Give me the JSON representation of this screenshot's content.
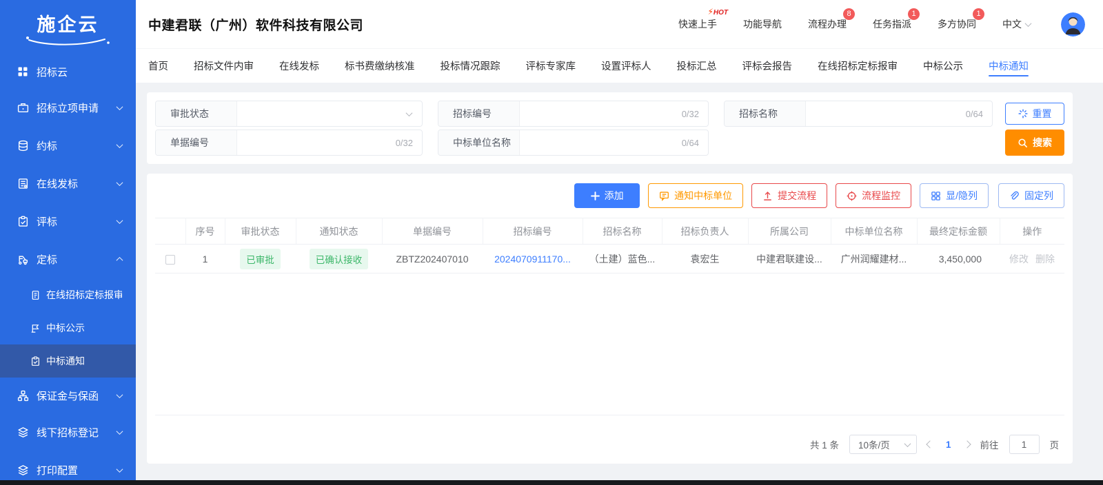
{
  "app": {
    "logo_text": "施企云"
  },
  "sidebar": {
    "items": [
      {
        "label": "招标云"
      },
      {
        "label": "招标立项申请"
      },
      {
        "label": "约标"
      },
      {
        "label": "在线发标"
      },
      {
        "label": "评标"
      },
      {
        "label": "定标"
      },
      {
        "label": "在线招标定标报审"
      },
      {
        "label": "中标公示"
      },
      {
        "label": "中标通知"
      },
      {
        "label": "保证金与保函"
      },
      {
        "label": "线下招标登记"
      },
      {
        "label": "打印配置"
      }
    ]
  },
  "header": {
    "company_title": "中建君联（广州）软件科技有限公司",
    "nav": [
      {
        "label": "快速上手",
        "badge": "HOT"
      },
      {
        "label": "功能导航"
      },
      {
        "label": "流程办理",
        "badge": "8"
      },
      {
        "label": "任务指派",
        "badge": "1"
      },
      {
        "label": "多方协同",
        "badge": "1"
      }
    ],
    "language": "中文"
  },
  "tabs": [
    "首页",
    "招标文件内审",
    "在线发标",
    "标书费缴纳核准",
    "投标情况跟踪",
    "评标专家库",
    "设置评标人",
    "投标汇总",
    "评标会报告",
    "在线招标定标报审",
    "中标公示",
    "中标通知"
  ],
  "active_tab": "中标通知",
  "search": {
    "approval_label": "审批状态",
    "bid_no_label": "招标编号",
    "bid_no_counter": "0/32",
    "bid_name_label": "招标名称",
    "bid_name_counter": "0/64",
    "doc_no_label": "单据编号",
    "doc_no_counter": "0/32",
    "winner_label": "中标单位名称",
    "winner_counter": "0/64",
    "reset_label": "重置",
    "search_label": "搜索"
  },
  "toolbar": {
    "add": "添加",
    "notify": "通知中标单位",
    "submit": "提交流程",
    "monitor": "流程监控",
    "columns": "显/隐列",
    "pin": "固定列"
  },
  "table": {
    "headers": [
      "序号",
      "审批状态",
      "通知状态",
      "单据编号",
      "招标编号",
      "招标名称",
      "招标负责人",
      "所属公司",
      "中标单位名称",
      "最终定标金额",
      "操作"
    ],
    "rows": [
      {
        "seq": "1",
        "approval_status": "已审批",
        "notify_status": "已确认接收",
        "doc_no": "ZBTZ202407010",
        "bid_no": "2024070911170...",
        "bid_name": "（土建）蓝色...",
        "manager": "袁宏生",
        "company": "中建君联建设...",
        "winner": "广州润耀建材...",
        "amount": "3,450,000",
        "op_edit": "修改",
        "op_delete": "删除"
      }
    ]
  },
  "pagination": {
    "total": "共 1 条",
    "page_size": "10条/页",
    "current_page": "1",
    "goto_label": "前往",
    "goto_value": "1",
    "unit_label": "页"
  },
  "colors": {
    "sidebar_blue": "#2a6be1",
    "accent_blue": "#3d7eff",
    "search_orange": "#ff8d00",
    "danger_red": "#e84749",
    "warn_orange": "#ff9900",
    "status_green_text": "#3db76a",
    "status_green_bg": "#e7f8ee",
    "badge_red": "#f25a5a"
  }
}
